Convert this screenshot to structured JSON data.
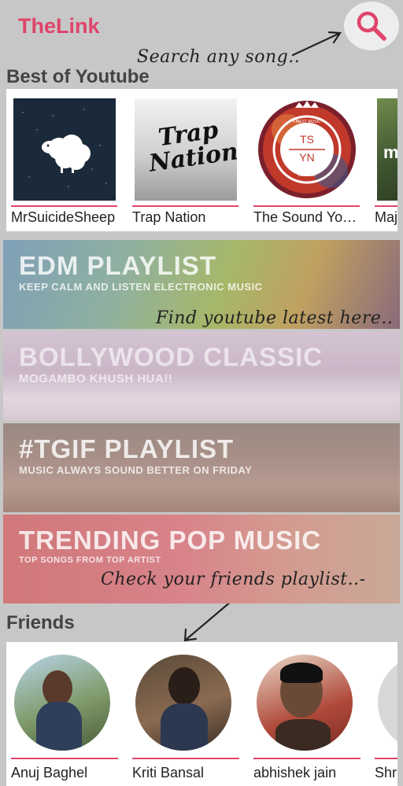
{
  "app": {
    "title": "TheLink"
  },
  "header": {
    "search_icon": "search-icon"
  },
  "hints": {
    "search": "Search any song..",
    "youtube": "Find youtube latest here..",
    "friends": "Check your friends playlist..-"
  },
  "sections": {
    "youtube_title": "Best of Youtube",
    "friends_title": "Friends"
  },
  "channels": [
    {
      "label": "MrSuicideSheep"
    },
    {
      "label": "Trap Nation"
    },
    {
      "label": "The Sound You Need"
    },
    {
      "label": "Majestic Casual"
    }
  ],
  "trap_logo": {
    "line1": "Trap",
    "line2": "Nation"
  },
  "sound_logo": {
    "line1": "TS",
    "line2": "YN",
    "top": "FINEST MUSIC",
    "bottom": "EST. 2010"
  },
  "playlists": [
    {
      "title": "EDM PLAYLIST",
      "subtitle": "KEEP CALM AND LISTEN ELECTRONIC MUSIC"
    },
    {
      "title": "BOLLYWOOD CLASSIC",
      "subtitle": "MOGAMBO KHUSH HUA!!"
    },
    {
      "title": "#TGIF PLAYLIST",
      "subtitle": "MUSIC ALWAYS SOUND BETTER ON FRIDAY"
    },
    {
      "title": "TRENDING POP MUSIC",
      "subtitle": "TOP SONGS FROM TOP ARTIST"
    }
  ],
  "friends": [
    {
      "label": "Anuj Baghel"
    },
    {
      "label": "Kriti Bansal"
    },
    {
      "label": "abhishek jain"
    },
    {
      "label": "Shruti"
    }
  ],
  "colors": {
    "accent": "#e0446a",
    "background": "#c7c7c7"
  }
}
